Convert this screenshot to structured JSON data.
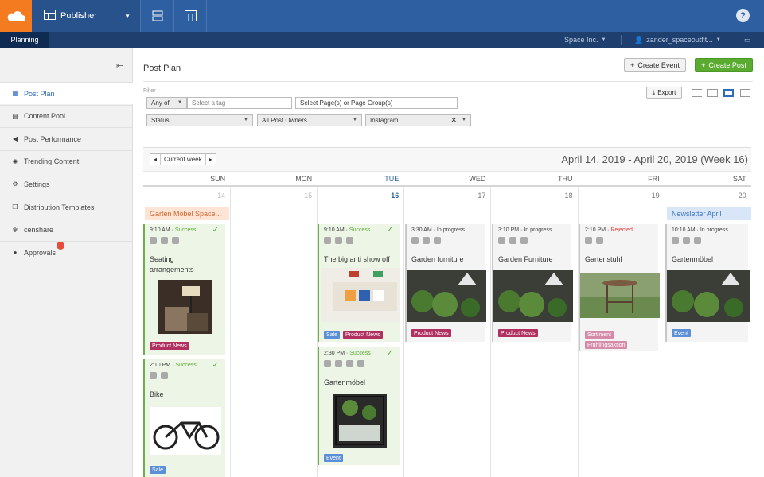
{
  "header": {
    "app_name": "Publisher",
    "help": "?"
  },
  "subnav": {
    "tab": "Planning",
    "org": "Space Inc.",
    "user": "zander_spaceoutfit..."
  },
  "sidebar": {
    "items": [
      {
        "label": "Post Plan",
        "icon": "calendar-icon"
      },
      {
        "label": "Content Pool",
        "icon": "content-pool-icon"
      },
      {
        "label": "Post Performance",
        "icon": "megaphone-icon"
      },
      {
        "label": "Trending Content",
        "icon": "lightbulb-icon"
      },
      {
        "label": "Settings",
        "icon": "gear-icon"
      },
      {
        "label": "Distribution Templates",
        "icon": "copy-icon"
      },
      {
        "label": "censhare",
        "icon": "censhare-icon"
      },
      {
        "label": "Approvals",
        "icon": "check-circle-icon"
      }
    ]
  },
  "page": {
    "title": "Post Plan",
    "create_event": "Create Event",
    "create_post": "Create Post",
    "export": "Export"
  },
  "filter": {
    "label": "Filter",
    "any_of": "Any of",
    "tag_placeholder": "Select a tag",
    "pages": "Select Page(s) or Page Group(s)",
    "status": "Status",
    "owners": "All Post Owners",
    "channel": "Instagram"
  },
  "calendar": {
    "nav": "Current week",
    "title": "April 14, 2019 - April 20, 2019 (Week 16)",
    "days": [
      {
        "name": "SUN",
        "num": "14"
      },
      {
        "name": "MON",
        "num": "15"
      },
      {
        "name": "TUE",
        "num": "16"
      },
      {
        "name": "WED",
        "num": "17"
      },
      {
        "name": "THU",
        "num": "18"
      },
      {
        "name": "FRI",
        "num": "19"
      },
      {
        "name": "SAT",
        "num": "20"
      }
    ],
    "events": {
      "sun": "Garten Möbel Space...",
      "sat": "Newsletter April"
    },
    "posts": {
      "sun1": {
        "time": "9:10 AM",
        "status": "Success",
        "title": "Seating arrangements",
        "tag": "Product News"
      },
      "sun2": {
        "time": "2:10 PM",
        "status": "Success",
        "title": "Bike",
        "tag": "Sale"
      },
      "tue1": {
        "time": "9:10 AM",
        "status": "Success",
        "title": "The big anti show off",
        "tag1": "Sale",
        "tag2": "Product News"
      },
      "tue2": {
        "time": "2:30 PM",
        "status": "Success",
        "title": "Gartenmöbel",
        "tag": "Event"
      },
      "wed1": {
        "time": "3:30 AM",
        "status": "In progress",
        "title": "Garden furniture",
        "tag": "Product News"
      },
      "thu1": {
        "time": "3:10 PM",
        "status": "In progress",
        "title": "Garden Furniture",
        "tag": "Product News"
      },
      "fri1": {
        "time": "2:10 PM",
        "status": "Rejected",
        "title": "Gartenstuhl",
        "tag1": "Sortiment",
        "tag2": "Frühlingsaktion"
      },
      "sat1": {
        "time": "10:10 AM",
        "status": "In progress",
        "title": "Gartenmöbel",
        "tag": "Event"
      }
    }
  },
  "colors": {
    "brand": "#2e5fa0",
    "accent": "#f47b20",
    "success": "#5aab30",
    "rejected": "#e04040"
  }
}
